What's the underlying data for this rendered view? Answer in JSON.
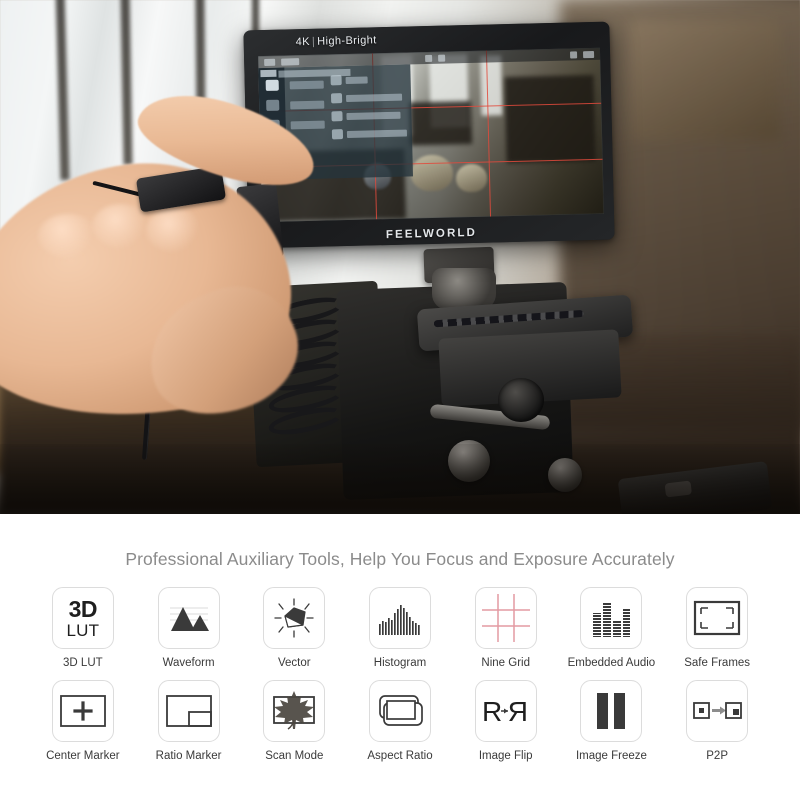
{
  "hero": {
    "monitor": {
      "mode_label_4k": "4K",
      "mode_label_sep": "|",
      "mode_label_bright": "High-Bright",
      "brand": "FEELWORLD"
    }
  },
  "features": {
    "heading": "Professional Auxiliary Tools, Help You Focus and Exposure Accurately",
    "items": [
      {
        "label": "3D LUT",
        "icon": "lut-icon",
        "lut_top": "3D",
        "lut_bottom": "LUT"
      },
      {
        "label": "Waveform",
        "icon": "waveform-icon"
      },
      {
        "label": "Vector",
        "icon": "vectorscope-icon"
      },
      {
        "label": "Histogram",
        "icon": "histogram-icon"
      },
      {
        "label": "Nine Grid",
        "icon": "nine-grid-icon"
      },
      {
        "label": "Embedded Audio",
        "icon": "audio-meter-icon"
      },
      {
        "label": "Safe Frames",
        "icon": "safe-frames-icon"
      },
      {
        "label": "Center Marker",
        "icon": "center-marker-icon"
      },
      {
        "label": "Ratio Marker",
        "icon": "ratio-marker-icon"
      },
      {
        "label": "Scan Mode",
        "icon": "maple-leaf-icon"
      },
      {
        "label": "Aspect Ratio",
        "icon": "aspect-ratio-icon"
      },
      {
        "label": "Image Flip",
        "icon": "image-flip-icon",
        "flip_left": "R",
        "flip_right": "R"
      },
      {
        "label": "Image Freeze",
        "icon": "pause-bars-icon"
      },
      {
        "label": "P2P",
        "icon": "pixel-to-pixel-icon"
      }
    ]
  },
  "colors": {
    "heading_text": "#8b8b8b",
    "label_text": "#3a3a3a",
    "tile_border": "#dcdcdc",
    "icon_dark": "#3a3a3a",
    "grid_red": "#e39aa2",
    "page_bg": "#ffffff"
  }
}
